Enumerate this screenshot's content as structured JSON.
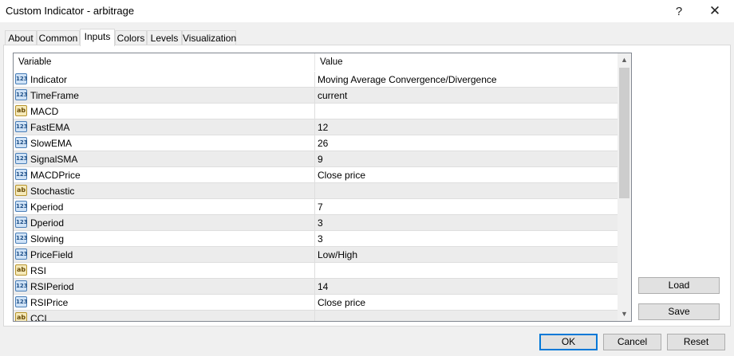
{
  "window": {
    "title": "Custom Indicator - arbitrage",
    "help_glyph": "?",
    "close_glyph": "✕"
  },
  "tabs": [
    {
      "label": "About"
    },
    {
      "label": "Common"
    },
    {
      "label": "Inputs",
      "active": true
    },
    {
      "label": "Colors"
    },
    {
      "label": "Levels"
    },
    {
      "label": "Visualization"
    }
  ],
  "grid": {
    "headers": {
      "variable": "Variable",
      "value": "Value"
    },
    "rows": [
      {
        "variable": "Indicator",
        "value": "Moving Average Convergence/Divergence",
        "type": "123"
      },
      {
        "variable": "TimeFrame",
        "value": "current",
        "type": "123"
      },
      {
        "variable": "MACD",
        "value": "",
        "type": "ab"
      },
      {
        "variable": "FastEMA",
        "value": "12",
        "type": "123"
      },
      {
        "variable": "SlowEMA",
        "value": "26",
        "type": "123"
      },
      {
        "variable": "SignalSMA",
        "value": "9",
        "type": "123"
      },
      {
        "variable": "MACDPrice",
        "value": "Close price",
        "type": "123"
      },
      {
        "variable": "Stochastic",
        "value": "",
        "type": "ab"
      },
      {
        "variable": "Kperiod",
        "value": "7",
        "type": "123"
      },
      {
        "variable": "Dperiod",
        "value": "3",
        "type": "123"
      },
      {
        "variable": "Slowing",
        "value": "3",
        "type": "123"
      },
      {
        "variable": "PriceField",
        "value": "Low/High",
        "type": "123"
      },
      {
        "variable": "RSI",
        "value": "",
        "type": "ab"
      },
      {
        "variable": "RSIPeriod",
        "value": "14",
        "type": "123"
      },
      {
        "variable": "RSIPrice",
        "value": "Close price",
        "type": "123"
      },
      {
        "variable": "CCI",
        "value": "",
        "type": "ab"
      }
    ]
  },
  "side_buttons": {
    "load": "Load",
    "save": "Save"
  },
  "dialog_buttons": {
    "ok": "OK",
    "cancel": "Cancel",
    "reset": "Reset"
  },
  "scrollbar": {
    "up": "▲",
    "down": "▼"
  },
  "colors": {
    "accent": "#0078d7",
    "row_alt": "#ececec",
    "window_bg": "#f0f0f0"
  }
}
